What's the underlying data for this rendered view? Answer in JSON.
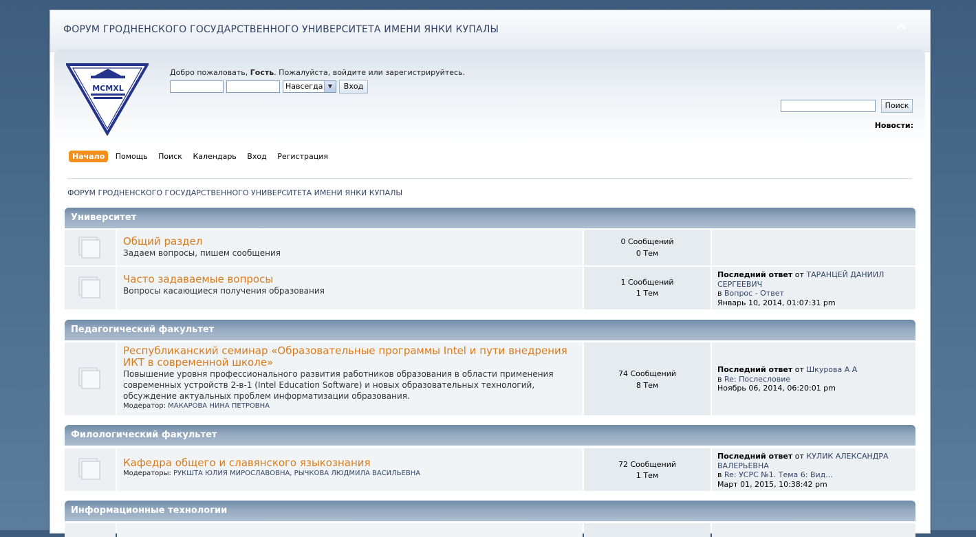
{
  "header": {
    "forum_title": "ФОРУМ ГРОДНЕНСКОГО ГОСУДАРСТВЕННОГО УНИВЕРСИТЕТА ИМЕНИ ЯНКИ КУПАЛЫ"
  },
  "logo": {
    "text": "MCMXL"
  },
  "login": {
    "welcome_prefix": "Добро пожаловать, ",
    "guest": "Гость",
    "welcome_suffix": ". Пожалуйста, войдите или зарегистрируйтесь.",
    "username_value": "",
    "password_value": "",
    "cookie_option": "Навсегда",
    "submit_label": "Вход"
  },
  "search": {
    "value": "",
    "button_label": "Поиск"
  },
  "news_label": "Новости:",
  "menu": {
    "items": [
      {
        "label": "Начало"
      },
      {
        "label": "Помощь"
      },
      {
        "label": "Поиск"
      },
      {
        "label": "Календарь"
      },
      {
        "label": "Вход"
      },
      {
        "label": "Регистрация"
      }
    ]
  },
  "linktree": "ФОРУМ ГРОДНЕНСКОГО ГОСУДАРСТВЕННОГО УНИВЕРСИТЕТА ИМЕНИ ЯНКИ КУПАЛЫ",
  "categories": [
    {
      "name": "Университет",
      "boards": [
        {
          "name": "Общий раздел",
          "desc": "Задаем вопросы, пишем сообщения",
          "posts": "0 Сообщений",
          "topics": "0 Тем"
        },
        {
          "name": "Часто задаваемые вопросы",
          "desc": "Вопросы касающиеся получения образования",
          "posts": "1 Сообщений",
          "topics": "1 Тем",
          "last_label": "Последний ответ",
          "by": " от ",
          "author": "ТАРАНЦЕЙ ДАНИИЛ СЕРГЕЕВИЧ",
          "in": "в ",
          "topic": "Вопрос - Ответ",
          "date": "Январь 10, 2014, 01:07:31 pm"
        }
      ]
    },
    {
      "name": "Педагогический факультет",
      "boards": [
        {
          "name": "Республиканский семинар «Образовательные программы Intel и пути внедрения ИКТ в современной школе»",
          "desc": "Повышение уровня профессионального развития работников образования в области применения современных устройств 2-в-1 (Intel Education Software) и новых образовательных технологий, обсуждение актуальных проблем информатизации образования.",
          "mod_label": "Модератор: ",
          "moderators": "МАКАРОВА НИНА ПЕТРОВНА",
          "posts": "74 Сообщений",
          "topics": "8 Тем",
          "last_label": "Последний ответ",
          "by": " от ",
          "author": "Шкурова А А",
          "in": "в ",
          "topic": "Re: Послесловие",
          "date": "Ноябрь 06, 2014, 06:20:01 pm"
        }
      ]
    },
    {
      "name": "Филологический факультет",
      "boards": [
        {
          "name": "Кафедра общего и славянского языкознания",
          "mod_label": "Модераторы: ",
          "moderators": "РУКШТА ЮЛИЯ МИРОСЛАВОВНА, РЫЧКОВА ЛЮДМИЛА ВАСИЛЬЕВНА",
          "posts": "72 Сообщений",
          "topics": "1 Тем",
          "last_label": "Последний ответ",
          "by": " от ",
          "author": "КУЛИК АЛЕКСАНДРА ВАЛЕРЬЕВНА",
          "in": "в ",
          "topic": "Re: УСРС №1. Тема 6: Вид...",
          "date": "Март 01, 2015, 10:38:42 pm"
        }
      ]
    },
    {
      "name": "Информационные технологии",
      "boards": []
    }
  ],
  "colors": {
    "accent": "#f3901d",
    "board_link": "#d97b1a",
    "category_header": "#7f98b3",
    "link": "#334466"
  }
}
